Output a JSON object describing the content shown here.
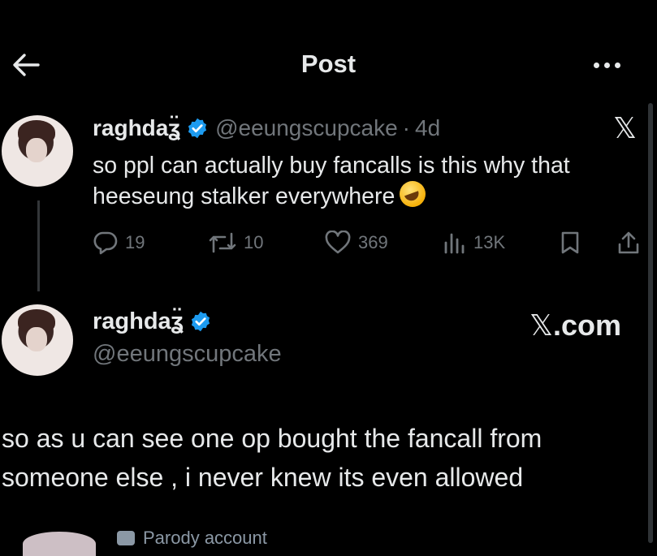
{
  "header": {
    "title": "Post"
  },
  "tweet": {
    "display_name": "raghdaʓ̈",
    "handle": "@eeungscupcake",
    "separator": "·",
    "time": "4d",
    "text_line1": "so ppl can actually buy fancalls is this why that",
    "text_line2": "heeseung stalker everywhere",
    "emoji": "rolling-on-floor-laughing",
    "stats": {
      "replies": "19",
      "reposts": "10",
      "likes": "369",
      "views": "13K"
    }
  },
  "quoted": {
    "display_name": "raghdaʓ̈",
    "handle": "@eeungscupcake",
    "brand": "X.com",
    "text_line1": "so as u can see one op bought the fancall from",
    "text_line2": "someone else , i never knew its even allowed"
  },
  "footer": {
    "parody_label": "Parody account"
  },
  "colors": {
    "background": "#000000",
    "text": "#e7e9ea",
    "secondary": "#71767b",
    "verified": "#1d9bf0"
  },
  "icons": [
    "back-arrow-icon",
    "more-icon",
    "verified-badge-icon",
    "x-logo-icon",
    "reply-icon",
    "repost-icon",
    "like-icon",
    "views-icon",
    "bookmark-icon",
    "share-icon"
  ]
}
